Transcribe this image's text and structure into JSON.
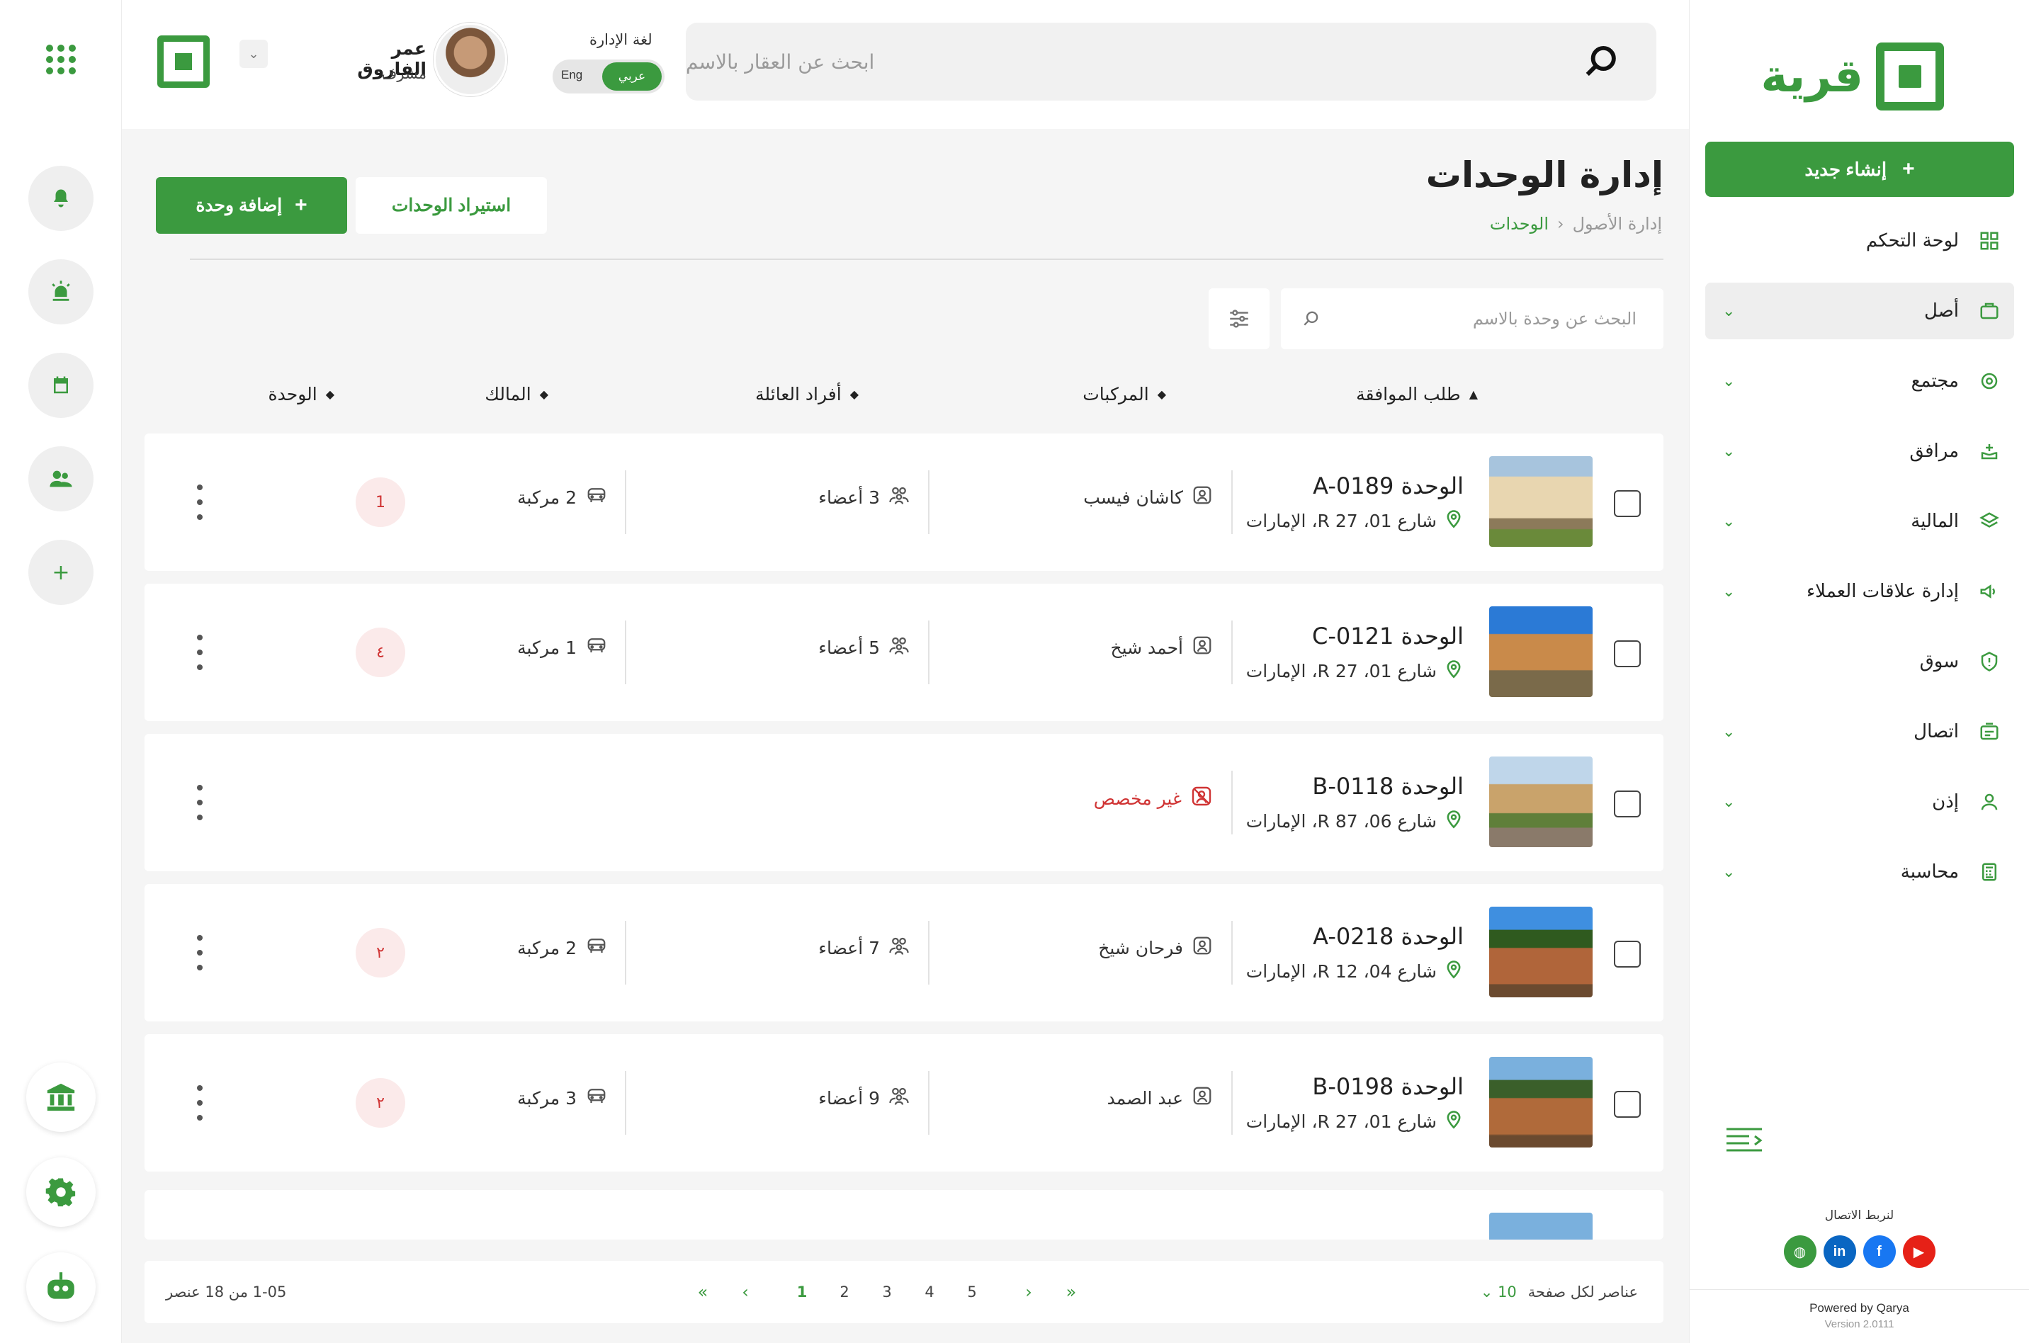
{
  "brand": {
    "name": "قرية",
    "color": "#3b9a3f",
    "danger": "#d03434"
  },
  "sidebar": {
    "create_label": "إنشاء جديد",
    "items": [
      {
        "label": "لوحة التحكم",
        "icon": "dashboard-icon",
        "chevron": false
      },
      {
        "label": "أصل",
        "icon": "asset-icon",
        "chevron": true,
        "active": true
      },
      {
        "label": "مجتمع",
        "icon": "community-icon",
        "chevron": true
      },
      {
        "label": "مرافق",
        "icon": "facilities-icon",
        "chevron": true
      },
      {
        "label": "المالية",
        "icon": "finance-icon",
        "chevron": true
      },
      {
        "label": "إدارة علاقات العملاء",
        "icon": "crm-icon",
        "chevron": true
      },
      {
        "label": "سوق",
        "icon": "market-icon",
        "chevron": false
      },
      {
        "label": "اتصال",
        "icon": "communication-icon",
        "chevron": true
      },
      {
        "label": "إذن",
        "icon": "permission-icon",
        "chevron": true
      },
      {
        "label": "محاسبة",
        "icon": "accounting-icon",
        "chevron": true
      }
    ],
    "connect_title": "لنربط الاتصال",
    "social": [
      "website-icon",
      "linkedin-icon",
      "facebook-icon",
      "youtube-icon"
    ],
    "powered_by": "Powered by Qarya",
    "version": "Version 2.0111"
  },
  "header": {
    "search_placeholder": "ابحث عن العقار بالاسم",
    "lang_label": "لغة الإدارة",
    "lang_en": "Eng",
    "lang_ar": "عربي",
    "user_name": "عمر الفاروق",
    "user_role": "مشرف"
  },
  "page": {
    "title": "إدارة الوحدات",
    "breadcrumb_parent": "إدارة الأصول",
    "breadcrumb_current": "الوحدات",
    "add_label": "إضافة وحدة",
    "import_label": "استيراد الوحدات",
    "unit_search_placeholder": "البحث عن وحدة بالاسم"
  },
  "table": {
    "headers": [
      "طلب الموافقة",
      "المركبات",
      "أفراد العائلة",
      "المالك",
      "الوحدة"
    ],
    "rows": [
      {
        "name": "الوحدة A-0189",
        "address": "شارع 01، R 27، الإمارات",
        "owner": "كاشان فيسب",
        "family": "3 أعضاء",
        "vehicles": "2 مركبة",
        "requests": "1"
      },
      {
        "name": "الوحدة C-0121",
        "address": "شارع 01، R 27، الإمارات",
        "owner": "أحمد شيخ",
        "family": "5 أعضاء",
        "vehicles": "1 مركبة",
        "requests": "٤"
      },
      {
        "name": "الوحدة B-0118",
        "address": "شارع 06، R 87، الإمارات",
        "owner": "غير مخصص",
        "unassigned": true
      },
      {
        "name": "الوحدة A-0218",
        "address": "شارع 04، R 12، الإمارات",
        "owner": "فرحان شيخ",
        "family": "7 أعضاء",
        "vehicles": "2 مركبة",
        "requests": "٢"
      },
      {
        "name": "الوحدة B-0198",
        "address": "شارع 01، R 27، الإمارات",
        "owner": "عبد الصمد",
        "family": "9 أعضاء",
        "vehicles": "3 مركبة",
        "requests": "٢"
      }
    ]
  },
  "pagination": {
    "range": "1-05 من 18 عنصر",
    "pages": [
      "1",
      "2",
      "3",
      "4",
      "5"
    ],
    "current": "1",
    "per_page_label": "عناصر لكل صفحة",
    "per_page": "10"
  }
}
